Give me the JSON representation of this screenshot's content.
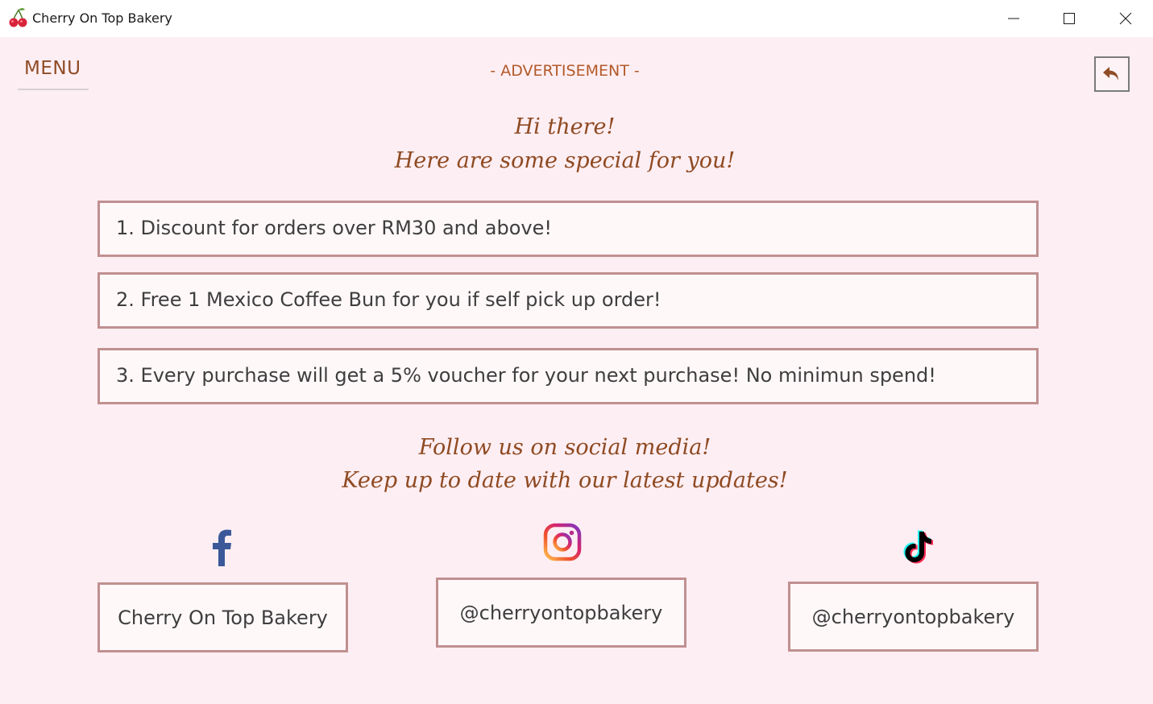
{
  "window": {
    "title": "Cherry On Top Bakery",
    "icon": "cherry-icon"
  },
  "header": {
    "menu_label": "MENU",
    "ad_label": "- ADVERTISEMENT -",
    "back_icon": "back-arrow-icon"
  },
  "greeting": {
    "line1": "Hi there!",
    "line2": "Here are some special for you!"
  },
  "offers": [
    "1. Discount for orders over RM30 and above!",
    "2. Free 1 Mexico Coffee Bun for you if self pick up order!",
    "3. Every purchase will get a 5% voucher for your next purchase! No minimun spend!"
  ],
  "follow": {
    "line1": "Follow us on social media!",
    "line2": "Keep up to date with our latest updates!"
  },
  "socials": [
    {
      "icon": "facebook-icon",
      "handle": "Cherry On Top Bakery"
    },
    {
      "icon": "instagram-icon",
      "handle": "@cherryontopbakery"
    },
    {
      "icon": "tiktok-icon",
      "handle": "@cherryontopbakery"
    }
  ],
  "colors": {
    "background": "#fdeef3",
    "accent": "#8f4a22",
    "box_border": "#c09090",
    "facebook": "#3b5998"
  }
}
